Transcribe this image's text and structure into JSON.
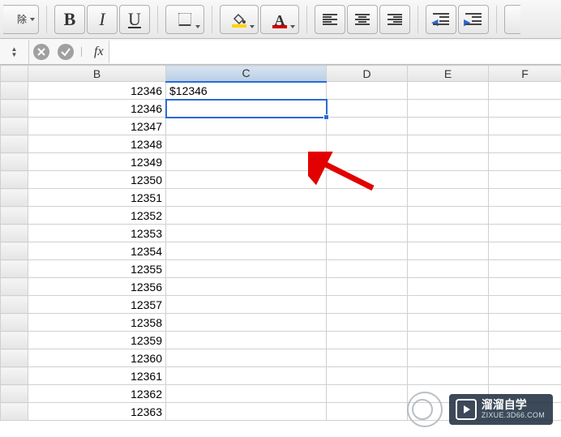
{
  "toolbar": {
    "left_partial": "除",
    "bold": "B",
    "italic": "I",
    "underline": "U",
    "font_color_letter": "A"
  },
  "formula_bar": {
    "fx_label": "fx",
    "value": ""
  },
  "columns": [
    "",
    "B",
    "C",
    "D",
    "E",
    "F"
  ],
  "selected_column_index": 2,
  "selected_cell": {
    "row": 1,
    "col": 2
  },
  "rows": [
    {
      "b": "12346",
      "c": "$12346"
    },
    {
      "b": "12346",
      "c": ""
    },
    {
      "b": "12347",
      "c": ""
    },
    {
      "b": "12348",
      "c": ""
    },
    {
      "b": "12349",
      "c": ""
    },
    {
      "b": "12350",
      "c": ""
    },
    {
      "b": "12351",
      "c": ""
    },
    {
      "b": "12352",
      "c": ""
    },
    {
      "b": "12353",
      "c": ""
    },
    {
      "b": "12354",
      "c": ""
    },
    {
      "b": "12355",
      "c": ""
    },
    {
      "b": "12356",
      "c": ""
    },
    {
      "b": "12357",
      "c": ""
    },
    {
      "b": "12358",
      "c": ""
    },
    {
      "b": "12359",
      "c": ""
    },
    {
      "b": "12360",
      "c": ""
    },
    {
      "b": "12361",
      "c": ""
    },
    {
      "b": "12362",
      "c": ""
    },
    {
      "b": "12363",
      "c": ""
    }
  ],
  "watermark": {
    "brand": "溜溜自学",
    "url": "ZIXUE.3D66.COM"
  }
}
